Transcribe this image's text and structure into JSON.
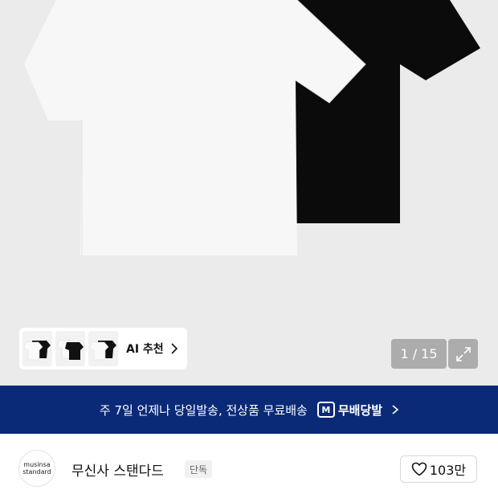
{
  "product": {
    "image_alt": "white and black short sleeve t-shirts",
    "image_counter": "1 / 15"
  },
  "ai_recommend": {
    "label": "AI 추천",
    "thumbnail_count": 3
  },
  "banner": {
    "text": "주 7일 언제나 당일발송, 전상품 무료배송",
    "badge_label": "무배당발",
    "badge_icon_letter": "M",
    "color": "#0a2a78"
  },
  "brand": {
    "logo_line1": "musinsa",
    "logo_line2": "standard",
    "name": "무신사 스탠다드",
    "badge": "단독"
  },
  "like": {
    "count": "103만"
  },
  "icons": [
    "chevron-right-icon",
    "expand-icon",
    "truck-icon",
    "heart-icon"
  ]
}
